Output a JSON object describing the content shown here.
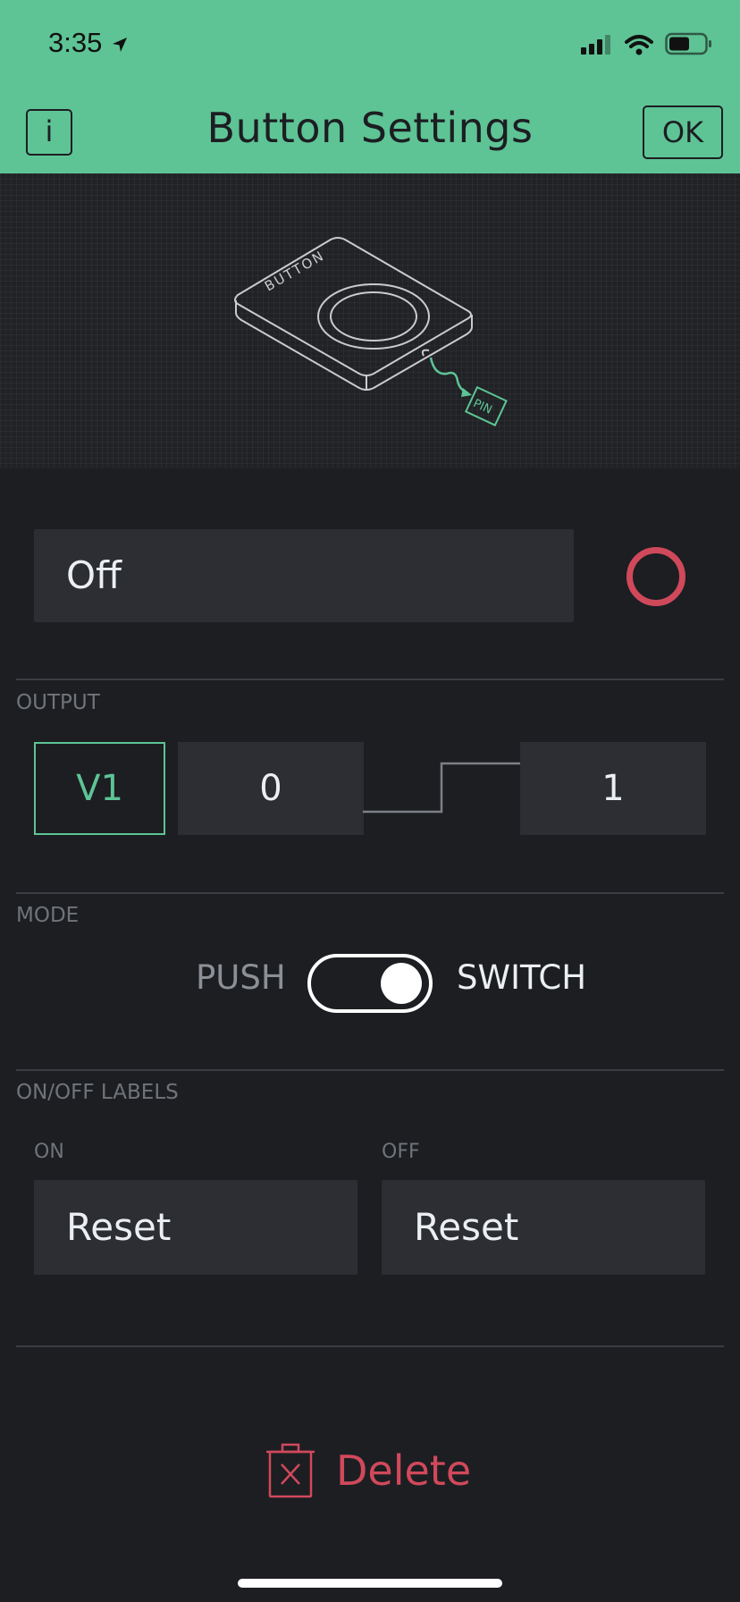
{
  "status_bar": {
    "time": "3:35"
  },
  "header": {
    "title": "Button Settings",
    "info_label": "i",
    "ok_label": "OK",
    "background": "#5ec495"
  },
  "illustration": {
    "button_label": "BUTTON",
    "pin_label": "PIN"
  },
  "label_field": {
    "value": "Off",
    "color": "#d0495b"
  },
  "output": {
    "title": "OUTPUT",
    "pin": "V1",
    "low_value": "0",
    "high_value": "1"
  },
  "mode": {
    "title": "MODE",
    "push_label": "PUSH",
    "switch_label": "SWITCH",
    "selected": "SWITCH"
  },
  "labels": {
    "title": "ON/OFF LABELS",
    "on_label": "ON",
    "on_value": "Reset",
    "off_label": "OFF",
    "off_value": "Reset"
  },
  "delete": {
    "label": "Delete",
    "icon": "trash-icon",
    "color": "#d0495b"
  },
  "colors": {
    "accent": "#5ec495",
    "background": "#1c1e22",
    "field": "#2c2e33",
    "danger": "#d0495b"
  }
}
